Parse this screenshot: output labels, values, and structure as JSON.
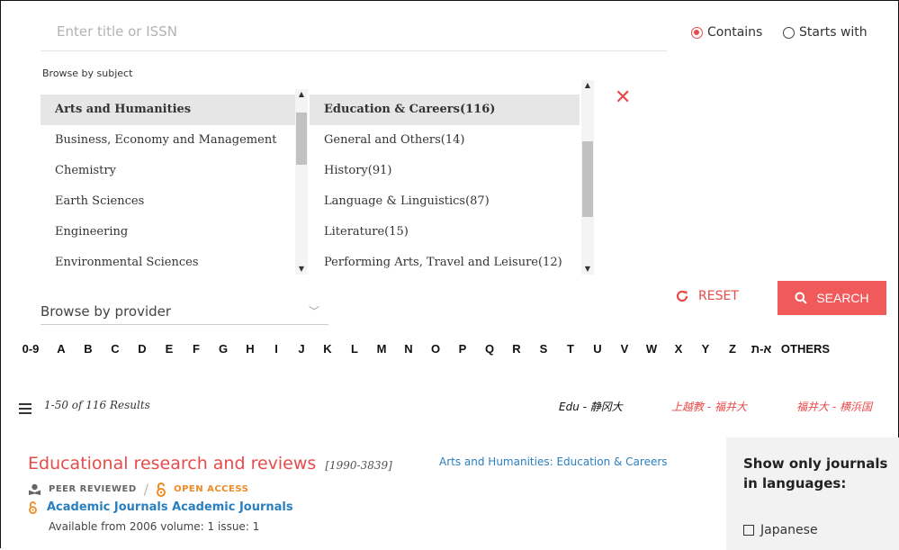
{
  "search": {
    "placeholder": "Enter title or ISSN",
    "value": ""
  },
  "match_mode": {
    "options": [
      {
        "label": "Contains",
        "selected": true
      },
      {
        "label": "Starts with",
        "selected": false
      }
    ]
  },
  "browse_subject": {
    "label": "Browse by subject",
    "subjects": [
      "Arts and Humanities",
      "Business, Economy and Management",
      "Chemistry",
      "Earth Sciences",
      "Engineering",
      "Environmental Sciences"
    ],
    "selected_subject": "Arts and Humanities",
    "subcategories": [
      "Education & Careers(116)",
      "General and Others(14)",
      "History(91)",
      "Language & Linguistics(87)",
      "Literature(15)",
      "Performing Arts, Travel and Leisure(12)"
    ],
    "selected_subcategory": "Education & Careers(116)",
    "clear_icon": "close-icon"
  },
  "browse_provider": {
    "label": "Browse by provider"
  },
  "actions": {
    "reset": "RESET",
    "search": "SEARCH"
  },
  "alphabet": [
    "0-9",
    "A",
    "B",
    "C",
    "D",
    "E",
    "F",
    "G",
    "H",
    "I",
    "J",
    "K",
    "L",
    "M",
    "N",
    "O",
    "P",
    "Q",
    "R",
    "S",
    "T",
    "U",
    "V",
    "W",
    "X",
    "Y",
    "Z",
    "א-ת",
    "OTHERS"
  ],
  "results": {
    "count_text": "1-50 of 116 Results",
    "crossrefs": [
      "Edu - 静冈大",
      "上越教 - 福井大",
      "福井大 - 横浜国"
    ]
  },
  "journal": {
    "title": "Educational research and reviews",
    "years": "[1990-3839]",
    "subject_link": "Arts and Humanities: Education & Careers",
    "peer_reviewed": "PEER REVIEWED",
    "separator": "/",
    "open_access": "OPEN ACCESS",
    "provider": "Academic Journals Academic Journals",
    "availability": "Available from 2006 volume: 1 issue: 1"
  },
  "side_panel": {
    "title_line1": "Show only journals",
    "title_line2": "in languages:",
    "languages": [
      {
        "label": "Japanese",
        "checked": false
      }
    ]
  },
  "colors": {
    "accent": "#e84a4a",
    "link": "#2a7fc1",
    "open_access": "#f08a24",
    "search_button": "#f15a5a"
  }
}
